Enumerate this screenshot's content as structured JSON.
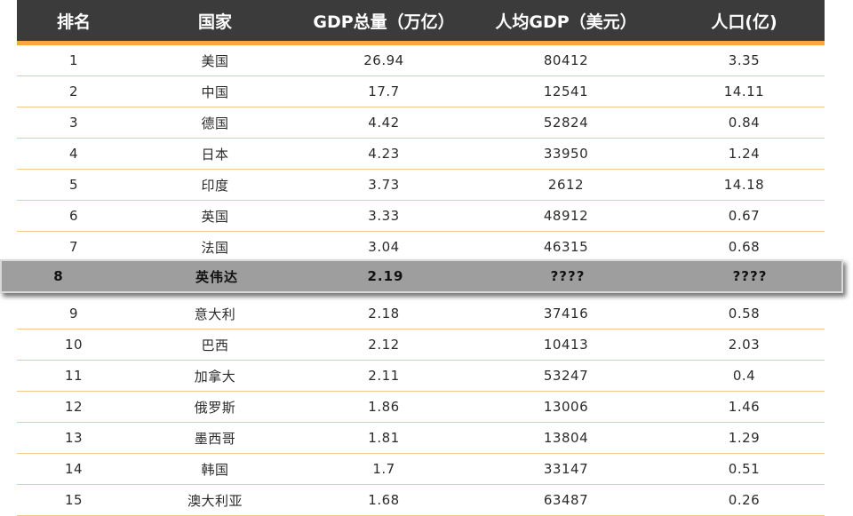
{
  "table": {
    "headers": [
      "排名",
      "国家",
      "GDP总量（万亿）",
      "人均GDP（美元）",
      "人口(亿)"
    ],
    "rows": [
      {
        "rank": "1",
        "country": "美国",
        "gdp": "26.94",
        "per_capita": "80412",
        "population": "3.35"
      },
      {
        "rank": "2",
        "country": "中国",
        "gdp": "17.7",
        "per_capita": "12541",
        "population": "14.11"
      },
      {
        "rank": "3",
        "country": "德国",
        "gdp": "4.42",
        "per_capita": "52824",
        "population": "0.84"
      },
      {
        "rank": "4",
        "country": "日本",
        "gdp": "4.23",
        "per_capita": "33950",
        "population": "1.24"
      },
      {
        "rank": "5",
        "country": "印度",
        "gdp": "3.73",
        "per_capita": "2612",
        "population": "14.18"
      },
      {
        "rank": "6",
        "country": "英国",
        "gdp": "3.33",
        "per_capita": "48912",
        "population": "0.67"
      },
      {
        "rank": "7",
        "country": "法国",
        "gdp": "3.04",
        "per_capita": "46315",
        "population": "0.68"
      },
      {
        "rank": "9",
        "country": "意大利",
        "gdp": "2.18",
        "per_capita": "37416",
        "population": "0.58"
      },
      {
        "rank": "10",
        "country": "巴西",
        "gdp": "2.12",
        "per_capita": "10413",
        "population": "2.03"
      },
      {
        "rank": "11",
        "country": "加拿大",
        "gdp": "2.11",
        "per_capita": "53247",
        "population": "0.4"
      },
      {
        "rank": "12",
        "country": "俄罗斯",
        "gdp": "1.86",
        "per_capita": "13006",
        "population": "1.46"
      },
      {
        "rank": "13",
        "country": "墨西哥",
        "gdp": "1.81",
        "per_capita": "13804",
        "population": "1.29"
      },
      {
        "rank": "14",
        "country": "韩国",
        "gdp": "1.7",
        "per_capita": "33147",
        "population": "0.51"
      },
      {
        "rank": "15",
        "country": "澳大利亚",
        "gdp": "1.68",
        "per_capita": "63487",
        "population": "0.26"
      }
    ],
    "highlight": {
      "rank": "8",
      "country": "英伟达",
      "gdp": "2.19",
      "per_capita": "????",
      "population": "????"
    }
  },
  "colors": {
    "header_bg": "#3b3b3b",
    "accent": "#f4a93a",
    "row_divider": "#f2c98a",
    "highlight_bg": "#9e9e9e"
  }
}
